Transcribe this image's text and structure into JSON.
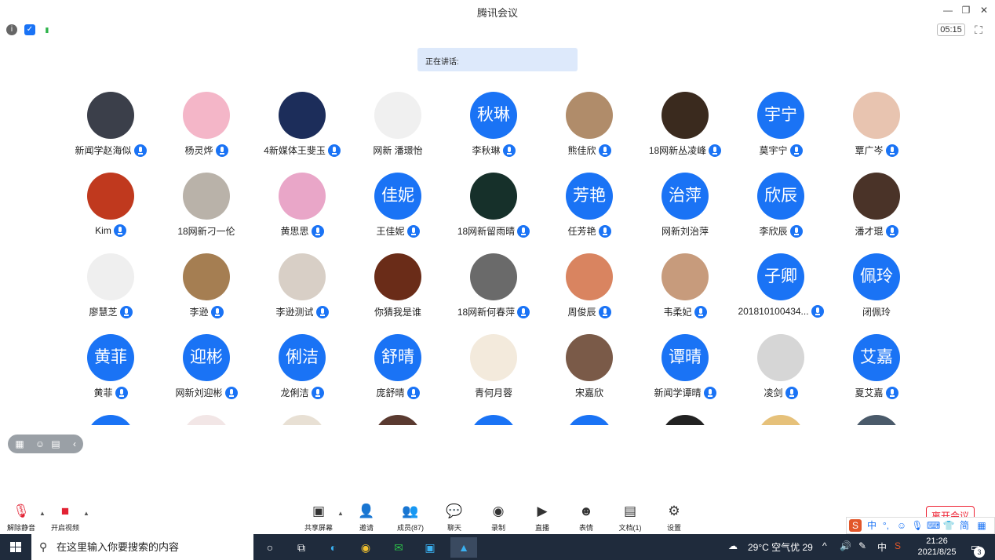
{
  "window": {
    "title": "腾讯会议",
    "minimize": "—",
    "restore": "❐",
    "close": "✕"
  },
  "infobar": {
    "timer": "05:15",
    "info_icon": "i",
    "shield_icon": "✓",
    "signal_icon": "▮"
  },
  "speaking": {
    "label": "正在讲话:"
  },
  "participants": [
    {
      "name": "新闻学赵海似",
      "avatar_text": "",
      "color": "#3b3f4a",
      "mic": true
    },
    {
      "name": "杨灵烨",
      "avatar_text": "",
      "color": "#f4b6c8",
      "mic": true
    },
    {
      "name": "4新媒体王斐玉",
      "avatar_text": "",
      "color": "#1c2d5a",
      "mic": true
    },
    {
      "name": "网新 潘璟怡",
      "avatar_text": "",
      "color": "#f0f0f0",
      "mic": false
    },
    {
      "name": "李秋琳",
      "avatar_text": "秋琳",
      "color": "#1a73f5",
      "mic": true
    },
    {
      "name": "熊佳欣",
      "avatar_text": "",
      "color": "#b08c6a",
      "mic": true
    },
    {
      "name": "18网新丛凌峰",
      "avatar_text": "",
      "color": "#3a2a1e",
      "mic": true
    },
    {
      "name": "莫宇宁",
      "avatar_text": "宇宁",
      "color": "#1a73f5",
      "mic": true
    },
    {
      "name": "覃广岑",
      "avatar_text": "",
      "color": "#e8c4b0",
      "mic": true
    },
    {
      "name": "Kim",
      "avatar_text": "",
      "color": "#c0391e",
      "mic": true
    },
    {
      "name": "18网新刁一伦",
      "avatar_text": "",
      "color": "#b9b2a9",
      "mic": false
    },
    {
      "name": "黄思思",
      "avatar_text": "",
      "color": "#e9a6c8",
      "mic": true
    },
    {
      "name": "王佳妮",
      "avatar_text": "佳妮",
      "color": "#1a73f5",
      "mic": true
    },
    {
      "name": "18网新留雨晴",
      "avatar_text": "",
      "color": "#16302a",
      "mic": true
    },
    {
      "name": "任芳艳",
      "avatar_text": "芳艳",
      "color": "#1a73f5",
      "mic": true
    },
    {
      "name": "网新刘治萍",
      "avatar_text": "治萍",
      "color": "#1a73f5",
      "mic": false
    },
    {
      "name": "李欣辰",
      "avatar_text": "欣辰",
      "color": "#1a73f5",
      "mic": true
    },
    {
      "name": "潘才琨",
      "avatar_text": "",
      "color": "#4a3328",
      "mic": true
    },
    {
      "name": "廖慧芝",
      "avatar_text": "",
      "color": "#efefef",
      "mic": true
    },
    {
      "name": "李逊",
      "avatar_text": "",
      "color": "#a57e52",
      "mic": true
    },
    {
      "name": "李逊测试",
      "avatar_text": "",
      "color": "#d8cfc6",
      "mic": true
    },
    {
      "name": "你猜我是谁",
      "avatar_text": "",
      "color": "#6a2c18",
      "mic": false
    },
    {
      "name": "18网新何春萍",
      "avatar_text": "",
      "color": "#6a6a6a",
      "mic": true
    },
    {
      "name": "周俊辰",
      "avatar_text": "",
      "color": "#d98460",
      "mic": true
    },
    {
      "name": "韦柔妃",
      "avatar_text": "",
      "color": "#c79b7c",
      "mic": true
    },
    {
      "name": "201810100434...",
      "avatar_text": "子卿",
      "color": "#1a73f5",
      "mic": true
    },
    {
      "name": "闭佩玲",
      "avatar_text": "佩玲",
      "color": "#1a73f5",
      "mic": false
    },
    {
      "name": "黄菲",
      "avatar_text": "黄菲",
      "color": "#1a73f5",
      "mic": true
    },
    {
      "name": "网新刘迎彬",
      "avatar_text": "迎彬",
      "color": "#1a73f5",
      "mic": true
    },
    {
      "name": "龙俐洁",
      "avatar_text": "俐洁",
      "color": "#1a73f5",
      "mic": true
    },
    {
      "name": "庞舒晴",
      "avatar_text": "舒晴",
      "color": "#1a73f5",
      "mic": true
    },
    {
      "name": "青何月蓉",
      "avatar_text": "",
      "color": "#f3eadc",
      "mic": false
    },
    {
      "name": "宋嘉欣",
      "avatar_text": "",
      "color": "#7a5a48",
      "mic": false
    },
    {
      "name": "新闻学谭晴",
      "avatar_text": "谭晴",
      "color": "#1a73f5",
      "mic": true
    },
    {
      "name": "凌剑",
      "avatar_text": "",
      "color": "#d6d6d6",
      "mic": true
    },
    {
      "name": "夏艾嘉",
      "avatar_text": "艾嘉",
      "color": "#1a73f5",
      "mic": true
    },
    {
      "name": "",
      "avatar_text": "",
      "color": "#1a73f5",
      "mic": false
    },
    {
      "name": "",
      "avatar_text": "",
      "color": "#f2e6e6",
      "mic": false
    },
    {
      "name": "",
      "avatar_text": "",
      "color": "#e8e0d4",
      "mic": false
    },
    {
      "name": "",
      "avatar_text": "",
      "color": "#5a3a30",
      "mic": false
    },
    {
      "name": "",
      "avatar_text": "",
      "color": "#1a73f5",
      "mic": false
    },
    {
      "name": "",
      "avatar_text": "",
      "color": "#1a73f5",
      "mic": false
    },
    {
      "name": "",
      "avatar_text": "",
      "color": "#222222",
      "mic": false
    },
    {
      "name": "",
      "avatar_text": "",
      "color": "#e6c17a",
      "mic": false
    },
    {
      "name": "",
      "avatar_text": "",
      "color": "#4a5a6a",
      "mic": false
    }
  ],
  "toolbar": {
    "unmute": "解除静音",
    "start_video": "开启视频",
    "share_screen": "共享屏幕",
    "invite": "邀请",
    "members": "成员(87)",
    "chat": "聊天",
    "record": "录制",
    "live": "直播",
    "reactions": "表情",
    "documents": "文档(1)",
    "settings": "设置",
    "leave": "离开会议"
  },
  "ime": {
    "logo": "S",
    "lang": "中",
    "punct": "°,"
  },
  "taskbar": {
    "search_placeholder": "在这里输入你要搜索的内容",
    "weather": "29°C 空气优 29",
    "ime_lang": "中",
    "time": "21:26",
    "date": "2021/8/25",
    "notification_count": "3"
  },
  "colors": {
    "accent": "#1a73f5",
    "taskbar": "#1f2b3c",
    "danger": "#e22233"
  }
}
